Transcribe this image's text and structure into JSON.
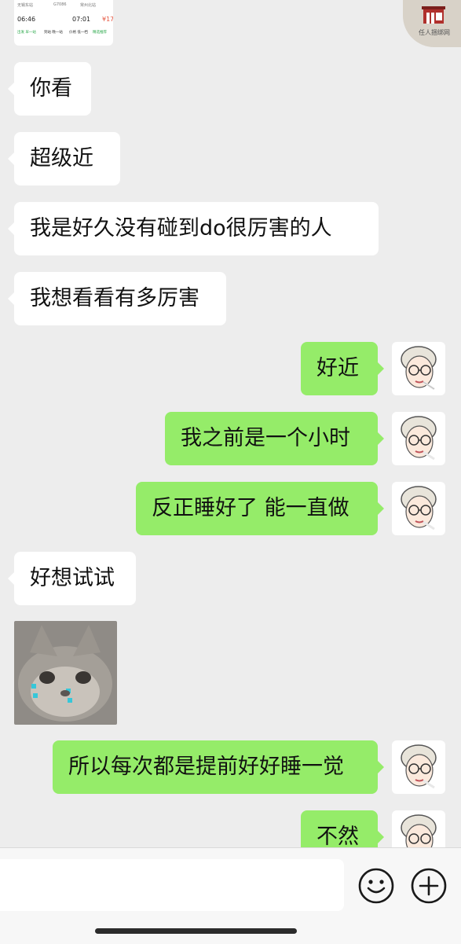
{
  "messages": [
    {
      "side": "left",
      "text": "你看"
    },
    {
      "side": "left",
      "text": "超级近"
    },
    {
      "side": "left",
      "text": "我是好久没有碰到do很厉害的人"
    },
    {
      "side": "left",
      "text": "我想看看有多厉害"
    },
    {
      "side": "right",
      "text": "好近"
    },
    {
      "side": "right",
      "text": "我之前是一个小时"
    },
    {
      "side": "right",
      "text": "反正睡好了 能一直做"
    },
    {
      "side": "left",
      "text": "好想试试"
    },
    {
      "side": "left",
      "type": "sticker",
      "sticker": "crying-cat-sticker"
    },
    {
      "side": "right",
      "text": "所以每次都是提前好好睡一觉"
    },
    {
      "side": "right",
      "text": "不然"
    }
  ],
  "preview_card": {
    "row1": [
      "无锡东站",
      "G7086",
      "常州北站"
    ],
    "row2": [
      "06:46",
      "07:01",
      "¥17"
    ],
    "row3": [
      "出发 早一站",
      "到站 晚一站",
      "价格 低一档",
      "精选推荐"
    ]
  },
  "watermark": {
    "text": "任人捆绑网",
    "icon": "building-logo-icon"
  },
  "input_bar": {
    "input_value": "",
    "emoji_icon": "emoji-icon",
    "plus_icon": "plus-icon"
  },
  "colors": {
    "background": "#ededed",
    "sent_bubble": "#95ec69",
    "received_bubble": "#ffffff"
  }
}
